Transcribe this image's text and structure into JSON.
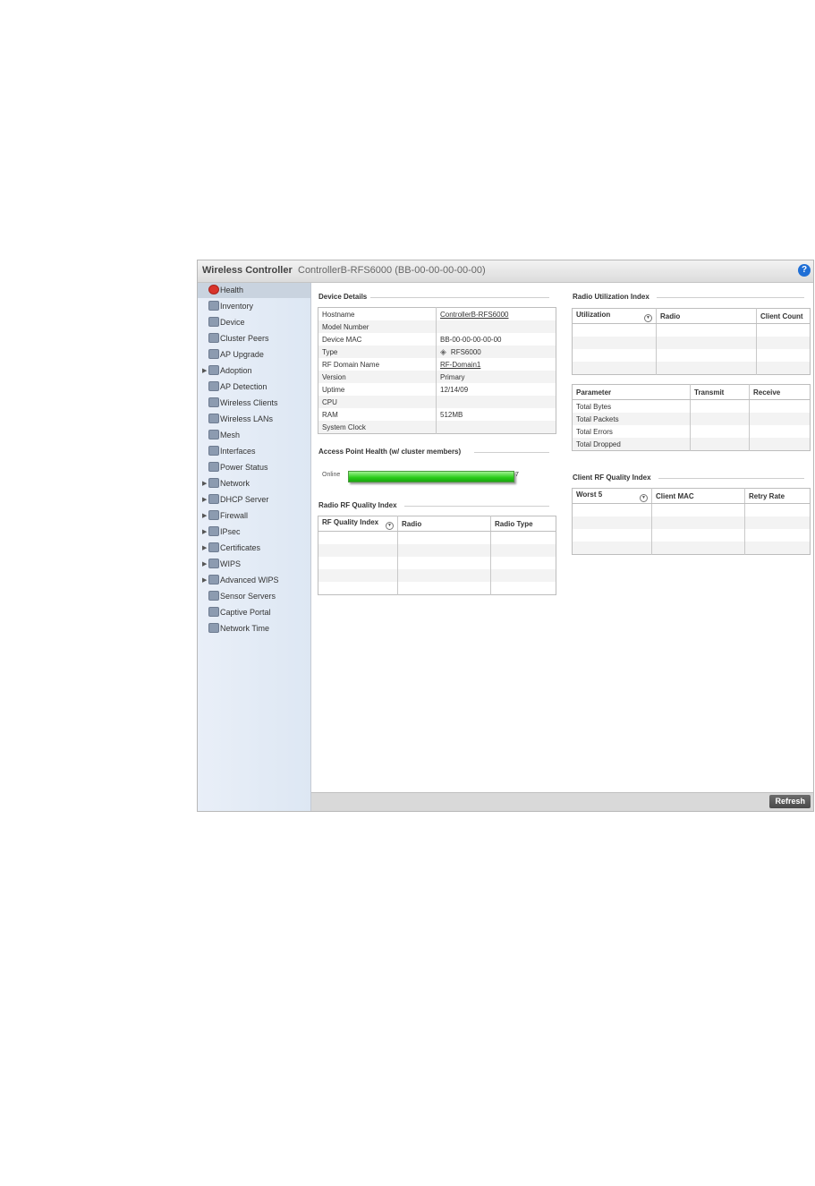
{
  "header": {
    "title": "Wireless Controller",
    "device": "ControllerB-RFS6000 (BB-00-00-00-00-00)",
    "help": "?"
  },
  "sidebar": [
    {
      "label": "Health",
      "icon": "health-icon",
      "active": true,
      "expandable": false
    },
    {
      "label": "Inventory",
      "icon": "inventory-icon",
      "expandable": false
    },
    {
      "label": "Device",
      "icon": "device-icon",
      "expandable": false
    },
    {
      "label": "Cluster Peers",
      "icon": "cluster-peers-icon",
      "expandable": false
    },
    {
      "label": "AP Upgrade",
      "icon": "ap-upgrade-icon",
      "expandable": false
    },
    {
      "label": "Adoption",
      "icon": "adoption-icon",
      "expandable": true
    },
    {
      "label": "AP Detection",
      "icon": "ap-detection-icon",
      "expandable": false
    },
    {
      "label": "Wireless Clients",
      "icon": "wireless-clients-icon",
      "expandable": false
    },
    {
      "label": "Wireless LANs",
      "icon": "wireless-lans-icon",
      "expandable": false
    },
    {
      "label": "Mesh",
      "icon": "mesh-icon",
      "expandable": false
    },
    {
      "label": "Interfaces",
      "icon": "interfaces-icon",
      "expandable": false
    },
    {
      "label": "Power Status",
      "icon": "power-status-icon",
      "expandable": false
    },
    {
      "label": "Network",
      "icon": "network-icon",
      "expandable": true
    },
    {
      "label": "DHCP Server",
      "icon": "dhcp-server-icon",
      "expandable": true
    },
    {
      "label": "Firewall",
      "icon": "firewall-icon",
      "expandable": true
    },
    {
      "label": "IPsec",
      "icon": "ipsec-icon",
      "expandable": true
    },
    {
      "label": "Certificates",
      "icon": "certificates-icon",
      "expandable": true
    },
    {
      "label": "WIPS",
      "icon": "wips-icon",
      "expandable": true
    },
    {
      "label": "Advanced WIPS",
      "icon": "advanced-wips-icon",
      "expandable": true
    },
    {
      "label": "Sensor Servers",
      "icon": "sensor-servers-icon",
      "expandable": false
    },
    {
      "label": "Captive Portal",
      "icon": "captive-portal-icon",
      "expandable": false
    },
    {
      "label": "Network Time",
      "icon": "network-time-icon",
      "expandable": false
    }
  ],
  "device_details": {
    "title": "Device Details",
    "rows": [
      {
        "label": "Hostname",
        "value": "ControllerB-RFS6000",
        "link": true
      },
      {
        "label": "Model Number",
        "value": ""
      },
      {
        "label": "Device MAC",
        "value": "BB-00-00-00-00-00"
      },
      {
        "label": "Type",
        "value": "RFS6000",
        "icon": "device-type-icon"
      },
      {
        "label": "RF Domain Name",
        "value": "RF-Domain1",
        "link": true
      },
      {
        "label": "Version",
        "value": "Primary"
      },
      {
        "label": "Uptime",
        "value": "12/14/09"
      },
      {
        "label": "CPU",
        "value": ""
      },
      {
        "label": "RAM",
        "value": "512MB"
      },
      {
        "label": "System Clock",
        "value": ""
      }
    ]
  },
  "ap_health": {
    "title": "Access Point Health (w/ cluster members)",
    "label": "Online",
    "count": "7",
    "fraction": 1.0
  },
  "radio_rf_quality": {
    "title": "Radio RF Quality Index",
    "columns": [
      "RF Quality Index",
      "Radio",
      "Radio Type"
    ],
    "empty_rows": 5
  },
  "radio_utilization": {
    "title": "Radio Utilization Index",
    "columns": [
      "Utilization",
      "Radio",
      "Client Count"
    ],
    "empty_rows": 4
  },
  "traffic": {
    "columns": [
      "Parameter",
      "Transmit",
      "Receive"
    ],
    "rows": [
      "Total Bytes",
      "Total Packets",
      "Total Errors",
      "Total Dropped"
    ]
  },
  "client_rf_quality": {
    "title": "Client RF Quality Index",
    "columns": [
      "Worst 5",
      "Client MAC",
      "Retry Rate"
    ],
    "empty_rows": 4
  },
  "footer": {
    "refresh_label": "Refresh"
  }
}
